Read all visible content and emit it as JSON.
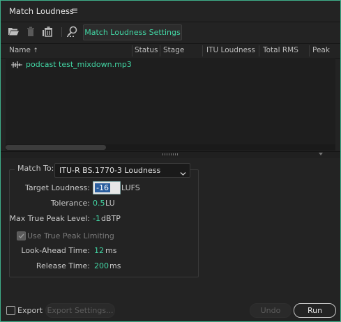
{
  "panel": {
    "title": "Match Loudness",
    "menu_glyph": "≡"
  },
  "toolbar": {
    "icons": [
      "folder-open-icon",
      "trash-icon",
      "clear-all-icon",
      "inspect-icon"
    ],
    "settings_button_label": "Match Loudness Settings"
  },
  "table": {
    "columns": [
      "Name",
      "Status",
      "Stage",
      "ITU Loudness",
      "Total RMS",
      "Peak"
    ],
    "sort_indicator": "↑",
    "rows": [
      {
        "name": "podcast test_mixdown.mp3",
        "icon": "waveform-icon"
      }
    ]
  },
  "settings": {
    "match_to_label": "Match To:",
    "match_to_value": "ITU-R BS.1770-3 Loudness",
    "target_loudness_label": "Target Loudness:",
    "target_loudness_value": "-16",
    "target_loudness_unit": "LUFS",
    "tolerance_label": "Tolerance:",
    "tolerance_value": "0.5",
    "tolerance_unit": "LU",
    "max_true_peak_label": "Max True Peak Level:",
    "max_true_peak_value": "-1",
    "max_true_peak_unit": "dBTP",
    "use_true_peak_label": "Use True Peak Limiting",
    "use_true_peak_checked": true,
    "look_ahead_label": "Look-Ahead Time:",
    "look_ahead_value": "12",
    "look_ahead_unit": "ms",
    "release_label": "Release Time:",
    "release_value": "200",
    "release_unit": "ms"
  },
  "footer": {
    "export_label": "Export",
    "export_checked": false,
    "export_settings_label": "Export Settings...",
    "undo_label": "Undo",
    "run_label": "Run"
  },
  "colors": {
    "accent": "#42d6a4",
    "frame": "#3fb08a",
    "background": "#232323"
  }
}
